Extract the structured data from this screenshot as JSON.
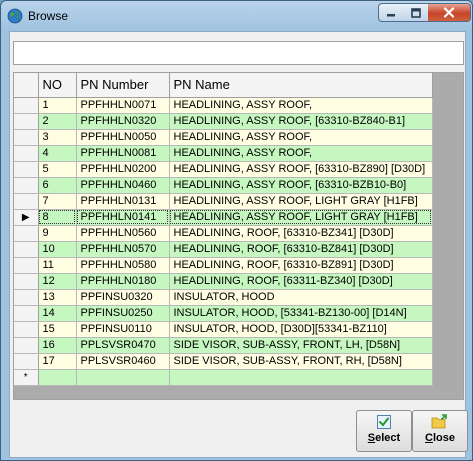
{
  "window": {
    "title": "Browse"
  },
  "filter": {
    "value": "",
    "placeholder": ""
  },
  "grid": {
    "columns": [
      "",
      "NO",
      "PN Number",
      "PN Name"
    ],
    "current_row_marker": "▶",
    "new_row_marker": "*",
    "selected_index": 7,
    "rows": [
      {
        "no": "1",
        "pn": "PPFHHLN0071",
        "name": "HEADLINING, ASSY ROOF,"
      },
      {
        "no": "2",
        "pn": "PPFHHLN0320",
        "name": "HEADLINING, ASSY ROOF, [63310-BZ840-B1]"
      },
      {
        "no": "3",
        "pn": "PPFHHLN0050",
        "name": "HEADLINING, ASSY ROOF,"
      },
      {
        "no": "4",
        "pn": "PPFHHLN0081",
        "name": "HEADLINING, ASSY ROOF,"
      },
      {
        "no": "5",
        "pn": "PPFHHLN0200",
        "name": "HEADLINING, ASSY ROOF, [63310-BZ890] [D30D]"
      },
      {
        "no": "6",
        "pn": "PPFHHLN0460",
        "name": "HEADLINING, ASSY ROOF, [63310-BZB10-B0]"
      },
      {
        "no": "7",
        "pn": "PPFHHLN0131",
        "name": "HEADLINING, ASSY ROOF, LIGHT GRAY [H1FB]"
      },
      {
        "no": "8",
        "pn": "PPFHHLN0141",
        "name": "HEADLINING, ASSY ROOF, LIGHT GRAY [H1FB]"
      },
      {
        "no": "9",
        "pn": "PPFHHLN0560",
        "name": "HEADLINING, ROOF, [63310-BZ341] [D30D]"
      },
      {
        "no": "10",
        "pn": "PPFHHLN0570",
        "name": "HEADLINING, ROOF, [63310-BZ841] [D30D]"
      },
      {
        "no": "11",
        "pn": "PPFHHLN0580",
        "name": "HEADLINING, ROOF, [63310-BZ891] [D30D]"
      },
      {
        "no": "12",
        "pn": "PPFHHLN0180",
        "name": "HEADLINING, ROOF, [63311-BZ340] [D30D]"
      },
      {
        "no": "13",
        "pn": "PPFINSU0320",
        "name": "INSULATOR, HOOD"
      },
      {
        "no": "14",
        "pn": "PPFINSU0250",
        "name": "INSULATOR, HOOD, [53341-BZ130-00] [D14N]"
      },
      {
        "no": "15",
        "pn": "PPFINSU0110",
        "name": "INSULATOR, HOOD, [D30D][53341-BZ110]"
      },
      {
        "no": "16",
        "pn": "PPLSVSR0470",
        "name": "SIDE VISOR, SUB-ASSY, FRONT, LH, [D58N]"
      },
      {
        "no": "17",
        "pn": "PPLSVSR0460",
        "name": "SIDE VISOR, SUB-ASSY, FRONT, RH, [D58N]"
      }
    ]
  },
  "buttons": {
    "select": {
      "label": "Select",
      "accel": "S",
      "rest": "elect"
    },
    "close": {
      "label": "Close",
      "accel": "C",
      "rest": "lose"
    }
  },
  "colors": {
    "odd_row": "#fffde2",
    "even_row": "#c6f7c1",
    "grid_background": "#ababab"
  }
}
